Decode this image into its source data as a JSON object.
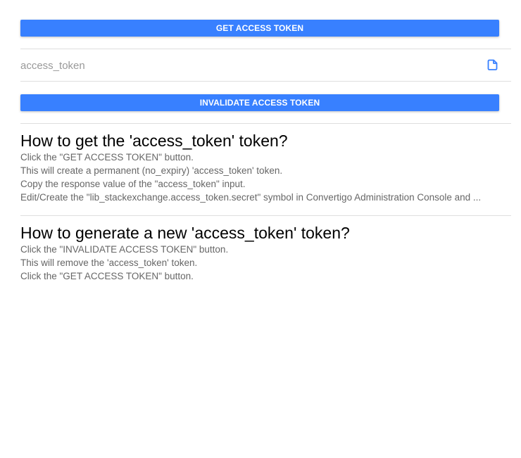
{
  "buttons": {
    "get_token": "GET ACCESS TOKEN",
    "invalidate_token": "INVALIDATE ACCESS TOKEN"
  },
  "token_field": {
    "placeholder": "access_token",
    "value": "",
    "copy_icon": "copy-icon"
  },
  "sections": [
    {
      "title": "How to get the 'access_token' token?",
      "lines": [
        "Click the \"GET ACCESS TOKEN\" button.",
        "This will create a permanent (no_expiry) 'access_token' token.",
        "Copy the response value of the \"access_token\" input.",
        "Edit/Create the \"lib_stackexchange.access_token.secret\" symbol in Convertigo Administration Console and ..."
      ]
    },
    {
      "title": "How to generate a new 'access_token' token?",
      "lines": [
        "Click the \"INVALIDATE ACCESS TOKEN\" button.",
        "This will remove the 'access_token' token.",
        "Click the \"GET ACCESS TOKEN\" button."
      ]
    }
  ],
  "colors": {
    "primary": "#3880ff",
    "divider": "#dedede",
    "body_text": "#666666"
  }
}
